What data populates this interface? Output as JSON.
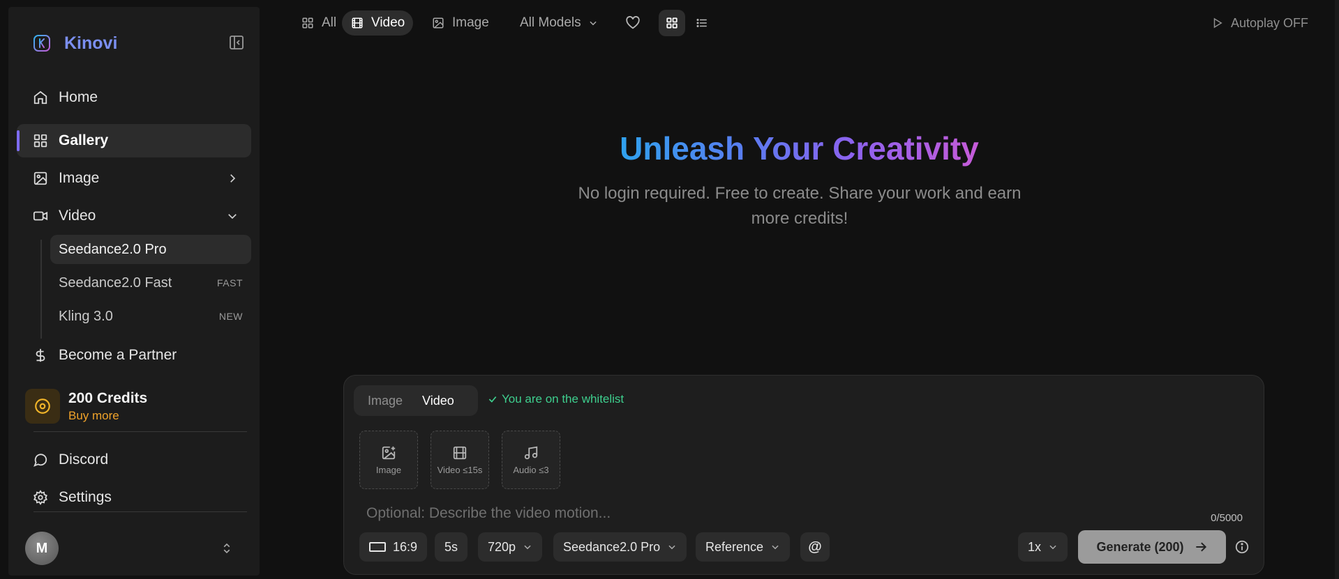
{
  "brand": {
    "name": "Kinovi"
  },
  "sidebar": {
    "home": "Home",
    "gallery": "Gallery",
    "image": "Image",
    "video": "Video",
    "video_items": [
      {
        "label": "Seedance2.0 Pro",
        "tag": ""
      },
      {
        "label": "Seedance2.0 Fast",
        "tag": "FAST"
      },
      {
        "label": "Kling 3.0",
        "tag": "NEW"
      }
    ],
    "partner": "Become a Partner",
    "credits": {
      "amount": "200 Credits",
      "buy": "Buy more"
    },
    "discord": "Discord",
    "settings": "Settings",
    "user_initial": "M"
  },
  "topbar": {
    "all": "All",
    "video": "Video",
    "image": "Image",
    "models": "All Models",
    "autoplay": "Autoplay OFF"
  },
  "hero": {
    "title": "Unleash Your Creativity",
    "subtitle": "No login required. Free to create. Share your work and earn more credits!"
  },
  "composer": {
    "mode_image": "Image",
    "mode_video": "Video",
    "whitelist": "You are on the whitelist",
    "uploads": {
      "image": "Image",
      "video": "Video ≤15s",
      "audio": "Audio ≤3"
    },
    "prompt_placeholder": "Optional: Describe the video motion...",
    "counter": "0/5000",
    "aspect": "16:9",
    "duration": "5s",
    "resolution": "720p",
    "model": "Seedance2.0 Pro",
    "mode": "Reference",
    "mention": "@",
    "multiplier": "1x",
    "generate": "Generate (200)"
  },
  "colors": {
    "accent": "#7d6cf2",
    "success": "#3ecf8e",
    "credits": "#f0a32a",
    "title_gradient": [
      "#2fa2ee",
      "#8d62ee",
      "#c65bd8"
    ]
  }
}
